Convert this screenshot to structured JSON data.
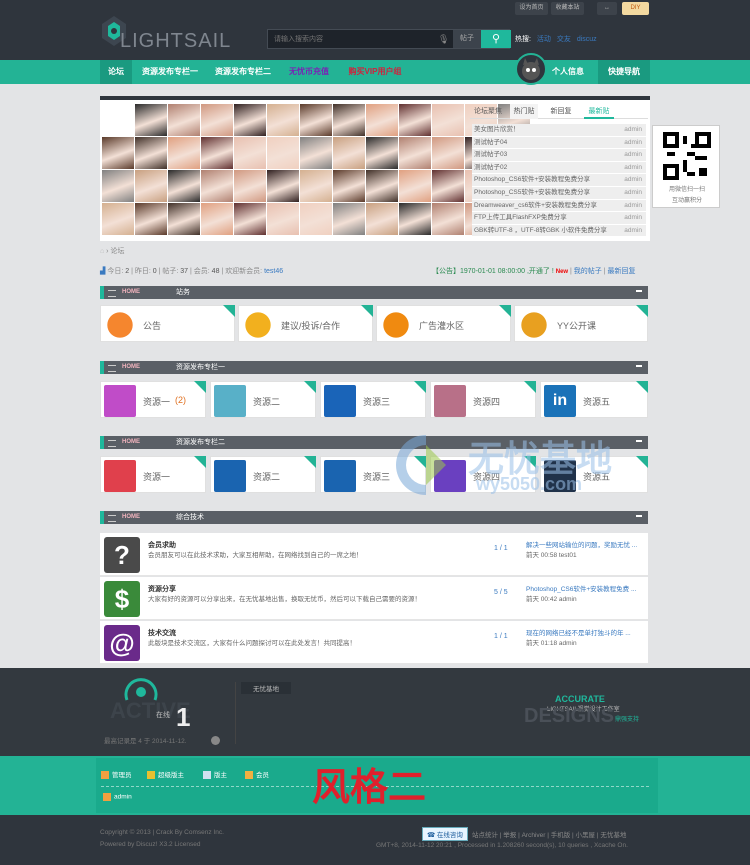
{
  "top_buttons": [
    "设为首页",
    "收藏本站",
    "DIY"
  ],
  "logo": "LIGHTSAIL",
  "search": {
    "placeholder": "请输入搜索内容",
    "category": "帖子",
    "hot_label": "热搜:",
    "hot": [
      "活动",
      "交友",
      "discuz"
    ]
  },
  "nav": [
    "论坛",
    "资源发布专栏一",
    "资源发布专栏二",
    "无忧币充值",
    "购买VIP用户组"
  ],
  "nav_right": [
    "个人信息",
    "快捷导航"
  ],
  "tabs": [
    "论坛聚焦",
    "热门贴",
    "新回复",
    "最新贴"
  ],
  "posts": [
    {
      "t": "美女图片欣赏！",
      "a": "admin"
    },
    {
      "t": "测试帖子04",
      "a": "admin"
    },
    {
      "t": "测试帖子03",
      "a": "admin"
    },
    {
      "t": "测试帖子02",
      "a": "admin"
    },
    {
      "t": "Photoshop_CS6软件+安装教程免费分享",
      "a": "admin"
    },
    {
      "t": "Photoshop_CS5软件+安装教程免费分享",
      "a": "admin"
    },
    {
      "t": "Dreamweaver_cs6软件+安装教程免费分享",
      "a": "admin"
    },
    {
      "t": "FTP上传工具FlashFXP免费分享",
      "a": "admin"
    },
    {
      "t": "GBK转UTF-8 ，UTF-8转GBK 小软件免费分享",
      "a": "admin"
    }
  ],
  "qr": [
    "用微信扫一扫",
    "互动赢积分"
  ],
  "crumb": "论坛",
  "stats": {
    "today": "今日: ",
    "today_v": "2",
    "y": "昨日: ",
    "y_v": "0",
    "posts": "帖子: ",
    "posts_v": "37",
    "members": "会员: ",
    "members_v": "48",
    "new": "欢迎新会员: ",
    "new_v": "test46"
  },
  "notice": {
    "text": "【公告】1970-01-01 08:00:00 ,开通了 !",
    "new": "New",
    "my": "我的帖子",
    "latest": "最新回复"
  },
  "sections": [
    {
      "home": "HOME",
      "title": "站务"
    },
    {
      "home": "HOME",
      "title": "资源发布专栏一"
    },
    {
      "home": "HOME",
      "title": "资源发布专栏二"
    },
    {
      "home": "HOME",
      "title": "综合技术"
    }
  ],
  "zw": [
    "公告",
    "建议/投诉/合作",
    "广告灌水区",
    "YY公开课"
  ],
  "r1": [
    "资源一",
    "资源二",
    "资源三",
    "资源四",
    "资源五"
  ],
  "r1_count": "(2)",
  "r2": [
    "资源一",
    "资源二",
    "资源三",
    "资源四",
    "资源五"
  ],
  "tech": [
    {
      "title": "会员求助",
      "desc": "会员朋友可以在此技术求助，大家互相帮助，在网络找到自己的一席之地！",
      "num": "1 / 1",
      "last": "解决一些网站输位的问题，奖励无忧 ...",
      "time": "前天 00:58 test01",
      "icon": "?"
    },
    {
      "title": "资源分享",
      "desc": "大家有好的资源可以分享出来，在无忧基地出售，换取无忧币，然后可以下载自己需要的资源！",
      "num": "5 / 5",
      "last": "Photoshop_CS6软件+安装教程免费 ...",
      "time": "前天 00:42 admin",
      "icon": "$"
    },
    {
      "title": "技术交流",
      "desc": "此版块是技术交流区，大家有什么问题探讨可以在此处发言！共同提高！",
      "num": "1 / 1",
      "last": "现在的网络已经不是单打独斗的年 ...",
      "time": "前天 01:18 admin",
      "icon": "@"
    }
  ],
  "footer": {
    "online": "在线",
    "active": "ACTIVE",
    "count": "1",
    "record": "最高记录是 4 于 2014-11-12.",
    "tag": "无忧基地",
    "acc": "ACCURATE",
    "acc2": "LIGHTSAIL视觉设计工作室",
    "designs": "DESIGNS",
    "support": "鼎强支持",
    "style": "风格二",
    "roles": [
      "管理员",
      "超级版主",
      "版主",
      "会员"
    ],
    "admin": "admin",
    "copy1": "Copyright © 2013 | Crack By Comsenz Inc.",
    "copy2": "Powered by Discuz! X3.2 Licensed",
    "links": "站点统计 | 举报 | Archiver | 手机版 | 小黑屋 | 无忧基地",
    "service": "在线咨询",
    "gmt": "GMT+8, 2014-11-12 20:21 , Processed in 1.208260 second(s), 10 queries , Xcache On."
  },
  "watermark": {
    "cn": "无忧基地",
    "en": "wy5050.com"
  }
}
